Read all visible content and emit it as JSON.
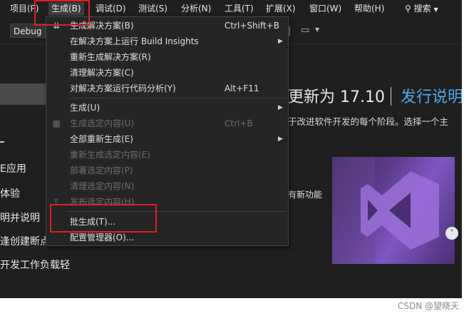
{
  "menubar": {
    "items": [
      "项目(P)",
      "生成(B)",
      "调试(D)",
      "测试(S)",
      "分析(N)",
      "工具(T)",
      "扩展(X)",
      "窗口(W)",
      "帮助(H)"
    ],
    "search_label": "搜索"
  },
  "toolbar": {
    "config": "Debug"
  },
  "build_menu": {
    "items": [
      {
        "label": "生成解决方案(B)",
        "shortcut": "Ctrl+Shift+B",
        "icon": "build-solution-icon"
      },
      {
        "label": "在解决方案上运行 Build Insights",
        "submenu": true
      },
      {
        "label": "重新生成解决方案(R)"
      },
      {
        "label": "清理解决方案(C)"
      },
      {
        "label": "对解决方案运行代码分析(Y)",
        "shortcut": "Alt+F11"
      },
      {
        "label": "生成(U)",
        "submenu": true
      },
      {
        "label": "生成选定内容(U)",
        "shortcut": "Ctrl+B",
        "disabled": true,
        "icon": "build-selection-icon"
      },
      {
        "label": "全部重新生成(E)",
        "submenu": true
      },
      {
        "label": "重新生成选定内容(E)",
        "disabled": true
      },
      {
        "label": "部署选定内容(P)",
        "disabled": true
      },
      {
        "label": "清理选定内容(N)",
        "disabled": true
      },
      {
        "label": "发布选定内容(H)",
        "disabled": true
      },
      {
        "label": "批生成(T)..."
      },
      {
        "label": "配置管理器(O)..."
      }
    ]
  },
  "start_page": {
    "headline": "更新为 17.10",
    "release_notes": "发行说明",
    "subline": "于改进软件开发的每个阶段。选择一个主",
    "left_items": [
      "E应用",
      "体验",
      "明并说明",
      "逢创建断点",
      "开发工作负载轻"
    ],
    "new_features": "有新功能"
  },
  "watermark": "CSDN @望晓天"
}
